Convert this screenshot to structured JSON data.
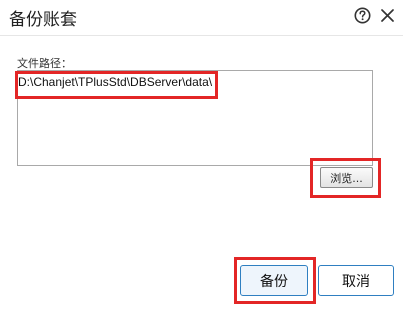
{
  "dialog": {
    "title": "备份账套",
    "help_icon": "help-circle-icon",
    "close_icon": "close-icon"
  },
  "path": {
    "label": "文件路径：",
    "value": "D:\\Chanjet\\TPlusStd\\DBServer\\data\\"
  },
  "buttons": {
    "browse": "浏览...",
    "backup": "备份",
    "cancel": "取消"
  },
  "colors": {
    "highlight": "#e32626",
    "button_border": "#2f7fc1"
  }
}
